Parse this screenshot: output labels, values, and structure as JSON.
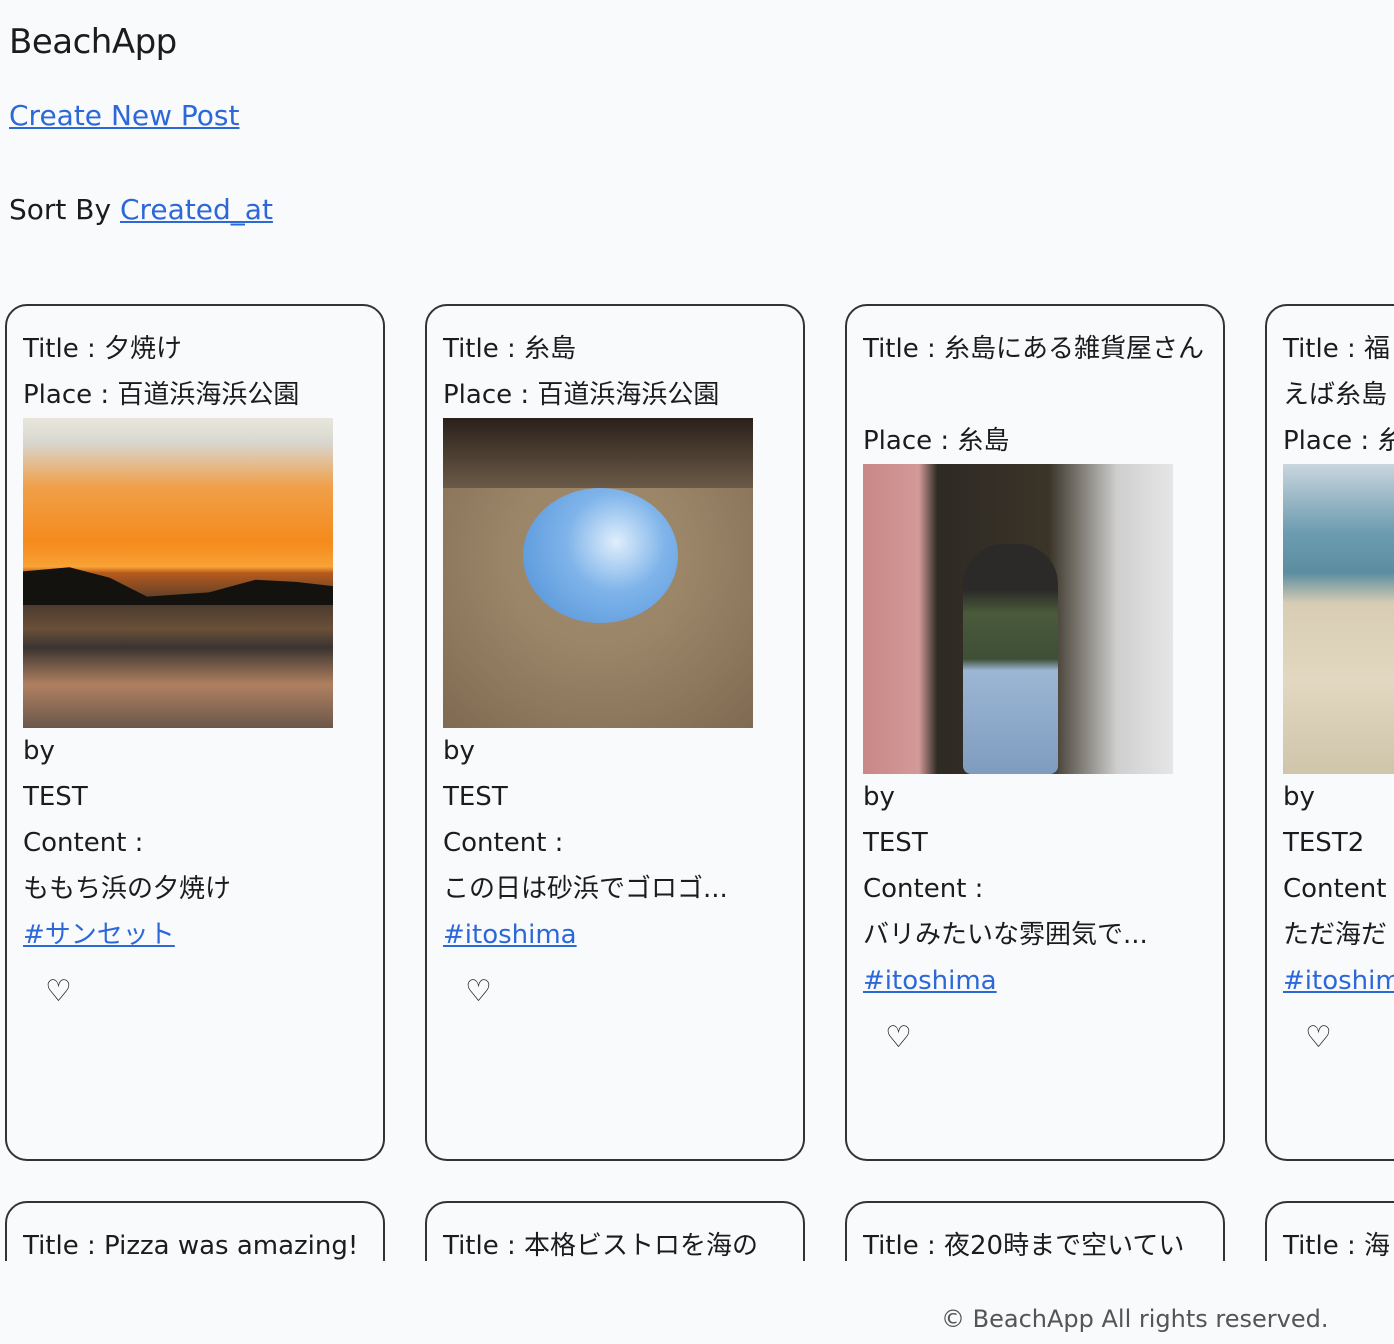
{
  "app": {
    "title": "BeachApp"
  },
  "nav": {
    "create_label": "Create New Post"
  },
  "sort": {
    "prefix": "Sort By",
    "link_label": "Created_at"
  },
  "posts": [
    {
      "title": "Title : 夕焼け",
      "place": "Place : 百道浜海浜公園",
      "by": "by",
      "author": "TEST",
      "content_label": "Content :",
      "content": "ももち浜の夕焼け",
      "tag": "#サンセット",
      "like_icon": "♡",
      "photo": "sunset-photo"
    },
    {
      "title": "Title : 糸島",
      "place": "Place : 百道浜海浜公園",
      "by": "by",
      "author": "TEST",
      "content_label": "Content :",
      "content": "この日は砂浜でゴロゴ...",
      "tag": "#itoshima",
      "like_icon": "♡",
      "photo": "sand-hole-photo"
    },
    {
      "title": "Title : 糸島にある雑貨屋さん",
      "place": "Place : 糸島",
      "by": "by",
      "author": "TEST",
      "content_label": "Content :",
      "content": "バリみたいな雰囲気で...",
      "tag": "#itoshima",
      "like_icon": "♡",
      "photo": "shop-photo"
    },
    {
      "title": "Title : 福",
      "title_line2": "えば糸島",
      "place": "Place : 糸",
      "by": "by",
      "author": "TEST2",
      "content_label": "Content",
      "content": "ただ海だ",
      "tag": "#itoshim",
      "like_icon": "♡",
      "photo": "beach-photo"
    }
  ],
  "posts_row2": [
    {
      "title": "Title : Pizza was amazing!"
    },
    {
      "title": "Title : 本格ビストロを海の"
    },
    {
      "title": "Title : 夜20時まで空いてい"
    },
    {
      "title": "Title : 海"
    }
  ],
  "footer": {
    "text": "© BeachApp All rights reserved."
  }
}
